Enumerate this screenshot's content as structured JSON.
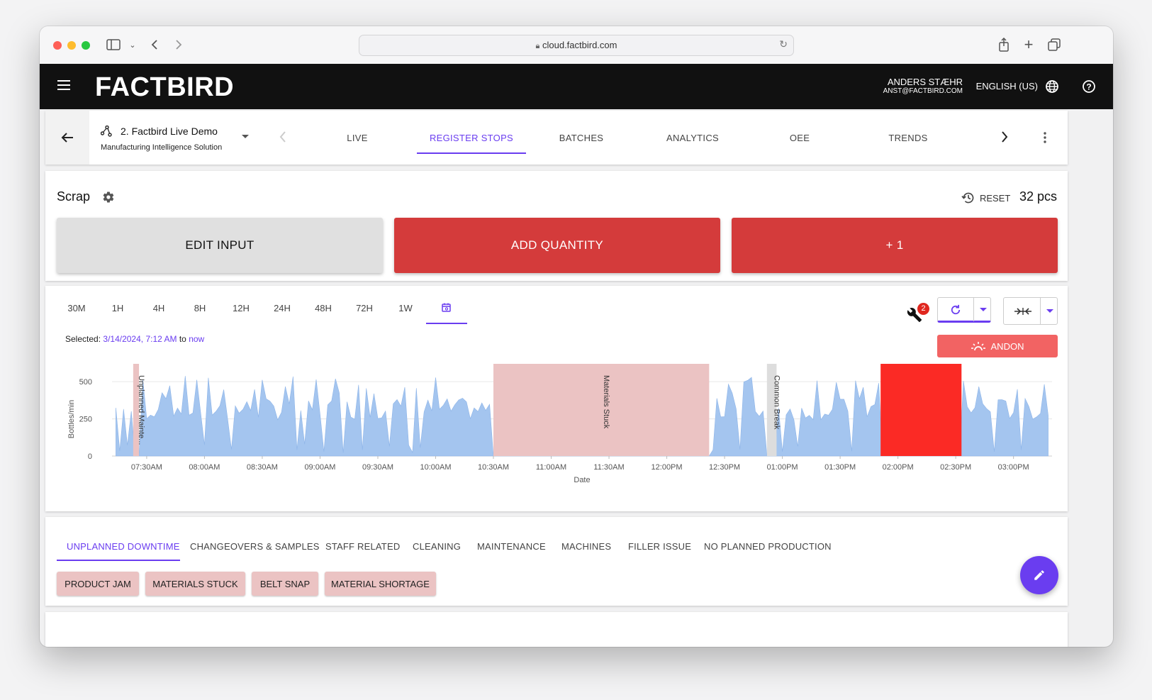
{
  "browser": {
    "url": "cloud.factbird.com"
  },
  "header": {
    "logo": "FACTBIRD",
    "user_name": "ANDERS STÆHR",
    "user_email": "ANST@FACTBIRD.COM",
    "language": "ENGLISH (US)"
  },
  "nav": {
    "line_title": "2. Factbird Live Demo",
    "line_subtitle": "Manufacturing Intelligence Solution",
    "tabs": [
      {
        "label": "LIVE"
      },
      {
        "label": "REGISTER STOPS"
      },
      {
        "label": "BATCHES"
      },
      {
        "label": "ANALYTICS"
      },
      {
        "label": "OEE"
      },
      {
        "label": "TRENDS"
      }
    ],
    "active_tab": "REGISTER STOPS"
  },
  "scrap": {
    "title": "Scrap",
    "reset_label": "RESET",
    "count": "32 pcs",
    "edit_label": "EDIT INPUT",
    "add_label": "ADD QUANTITY",
    "plus_label": "+ 1",
    "add_color": "#d43b3b",
    "edit_color": "#e0e0e0"
  },
  "time_range": {
    "options": [
      "30M",
      "1H",
      "4H",
      "8H",
      "12H",
      "24H",
      "48H",
      "72H",
      "1W"
    ],
    "active": "calendar",
    "selected_prefix": "Selected:",
    "selected_start": "3/14/2024, 7:12 AM",
    "selected_to": "to",
    "selected_end": "now",
    "maintenance_badge": "2",
    "andon_label": "ANDON"
  },
  "chart_data": {
    "type": "area",
    "x_start": "07:12",
    "x_end": "15:20",
    "xlabel": "Date",
    "ylabel": "Bottles/min",
    "ylim": [
      0,
      620
    ],
    "yticks": [
      0,
      250,
      500
    ],
    "xticks": [
      "07:30AM",
      "08:00AM",
      "08:30AM",
      "09:00AM",
      "09:30AM",
      "10:00AM",
      "10:30AM",
      "11:00AM",
      "11:30AM",
      "12:00PM",
      "12:30PM",
      "01:00PM",
      "01:30PM",
      "02:00PM",
      "02:30PM",
      "03:00PM"
    ],
    "series_color": "#a4c5ef",
    "stops": [
      {
        "label": "Unplanned Mainte...",
        "start": "07:23",
        "end": "07:26",
        "color": "#ebc3c3"
      },
      {
        "label": "Materials Stuck",
        "start": "10:30",
        "end": "12:22",
        "color": "#ebc3c3"
      },
      {
        "label": "Common Break",
        "start": "12:52",
        "end": "12:57",
        "color": "#dddddd"
      },
      {
        "label": "",
        "start": "13:51",
        "end": "14:33",
        "color": "#fb2a25"
      }
    ]
  },
  "categories": {
    "tabs": [
      {
        "label": "UNPLANNED DOWNTIME"
      },
      {
        "label": "CHANGEOVERS & SAMPLES"
      },
      {
        "label": "STAFF RELATED"
      },
      {
        "label": "CLEANING"
      },
      {
        "label": "MAINTENANCE"
      },
      {
        "label": "MACHINES"
      },
      {
        "label": "FILLER ISSUE"
      },
      {
        "label": "NO PLANNED PRODUCTION"
      }
    ],
    "active": "UNPLANNED DOWNTIME",
    "chips": [
      {
        "label": "PRODUCT JAM"
      },
      {
        "label": "MATERIALS STUCK"
      },
      {
        "label": "BELT SNAP"
      },
      {
        "label": "MATERIAL SHORTAGE"
      }
    ]
  }
}
